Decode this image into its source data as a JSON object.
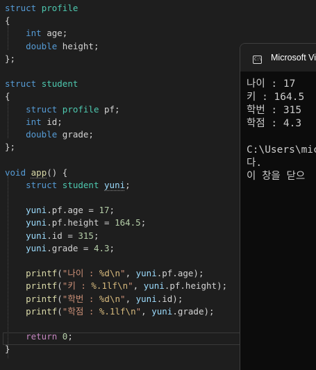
{
  "editor": {
    "lines": [
      [
        [
          "struct",
          "kw"
        ],
        [
          " ",
          "p"
        ],
        [
          "profile",
          "type"
        ]
      ],
      [
        [
          "{",
          "p"
        ]
      ],
      [
        [
          "    ",
          "p"
        ],
        [
          "int",
          "kw"
        ],
        [
          " age;",
          "p"
        ]
      ],
      [
        [
          "    ",
          "p"
        ],
        [
          "double",
          "kw"
        ],
        [
          " height;",
          "p"
        ]
      ],
      [
        [
          "};",
          "p"
        ]
      ],
      [],
      [
        [
          "struct",
          "kw"
        ],
        [
          " ",
          "p"
        ],
        [
          "student",
          "type"
        ]
      ],
      [
        [
          "{",
          "p"
        ]
      ],
      [
        [
          "    ",
          "p"
        ],
        [
          "struct",
          "kw"
        ],
        [
          " ",
          "p"
        ],
        [
          "profile",
          "type"
        ],
        [
          " pf;",
          "p"
        ]
      ],
      [
        [
          "    ",
          "p"
        ],
        [
          "int",
          "kw"
        ],
        [
          " id;",
          "p"
        ]
      ],
      [
        [
          "    ",
          "p"
        ],
        [
          "double",
          "kw"
        ],
        [
          " grade;",
          "p"
        ]
      ],
      [
        [
          "};",
          "p"
        ]
      ],
      [],
      [
        [
          "void",
          "kw"
        ],
        [
          " ",
          "p"
        ],
        [
          "app",
          "func_sq"
        ],
        [
          "() {",
          "p"
        ]
      ],
      [
        [
          "    ",
          "p"
        ],
        [
          "struct",
          "kw"
        ],
        [
          " ",
          "p"
        ],
        [
          "student",
          "type"
        ],
        [
          " ",
          "p"
        ],
        [
          "yuni",
          "var_sq"
        ],
        [
          ";",
          "p"
        ]
      ],
      [],
      [
        [
          "    ",
          "p"
        ],
        [
          "yuni",
          "var"
        ],
        [
          ".pf.age = ",
          "p"
        ],
        [
          "17",
          "num"
        ],
        [
          ";",
          "p"
        ]
      ],
      [
        [
          "    ",
          "p"
        ],
        [
          "yuni",
          "var"
        ],
        [
          ".pf.height = ",
          "p"
        ],
        [
          "164.5",
          "num"
        ],
        [
          ";",
          "p"
        ]
      ],
      [
        [
          "    ",
          "p"
        ],
        [
          "yuni",
          "var"
        ],
        [
          ".id = ",
          "p"
        ],
        [
          "315",
          "num"
        ],
        [
          ";",
          "p"
        ]
      ],
      [
        [
          "    ",
          "p"
        ],
        [
          "yuni",
          "var"
        ],
        [
          ".grade = ",
          "p"
        ],
        [
          "4.3",
          "num"
        ],
        [
          ";",
          "p"
        ]
      ],
      [],
      [
        [
          "    ",
          "p"
        ],
        [
          "printf",
          "func"
        ],
        [
          "(",
          "p"
        ],
        [
          "\"나이 : ",
          "str"
        ],
        [
          "%d",
          "esc"
        ],
        [
          "\\n",
          "esc"
        ],
        [
          "\"",
          "str"
        ],
        [
          ", ",
          "p"
        ],
        [
          "yuni",
          "var"
        ],
        [
          ".pf.age);",
          "p"
        ]
      ],
      [
        [
          "    ",
          "p"
        ],
        [
          "printf",
          "func"
        ],
        [
          "(",
          "p"
        ],
        [
          "\"키 : ",
          "str"
        ],
        [
          "%.1lf",
          "esc"
        ],
        [
          "\\n",
          "esc"
        ],
        [
          "\"",
          "str"
        ],
        [
          ", ",
          "p"
        ],
        [
          "yuni",
          "var"
        ],
        [
          ".pf.height);",
          "p"
        ]
      ],
      [
        [
          "    ",
          "p"
        ],
        [
          "printf",
          "func"
        ],
        [
          "(",
          "p"
        ],
        [
          "\"학번 : ",
          "str"
        ],
        [
          "%d",
          "esc"
        ],
        [
          "\\n",
          "esc"
        ],
        [
          "\"",
          "str"
        ],
        [
          ", ",
          "p"
        ],
        [
          "yuni",
          "var"
        ],
        [
          ".id);",
          "p"
        ]
      ],
      [
        [
          "    ",
          "p"
        ],
        [
          "printf",
          "func"
        ],
        [
          "(",
          "p"
        ],
        [
          "\"학점 : ",
          "str"
        ],
        [
          "%.1lf",
          "esc"
        ],
        [
          "\\n",
          "esc"
        ],
        [
          "\"",
          "str"
        ],
        [
          ", ",
          "p"
        ],
        [
          "yuni",
          "var"
        ],
        [
          ".grade);",
          "p"
        ]
      ],
      [],
      [
        [
          "    ",
          "p"
        ],
        [
          "return",
          "ctrl"
        ],
        [
          " ",
          "p"
        ],
        [
          "0",
          "num"
        ],
        [
          ";",
          "p"
        ]
      ],
      [
        [
          "}",
          "p"
        ]
      ]
    ]
  },
  "console": {
    "title": "Microsoft Vi",
    "icon": "terminal-icon",
    "output": "나이 : 17\n키 : 164.5\n학번 : 315\n학점 : 4.3\n\nC:\\Users\\mic\n다.\n이 창을 닫으"
  },
  "colors": {
    "background": "#1e1e1e",
    "kw": "#569cd6",
    "type": "#4ec9b0",
    "func": "#dcdcaa",
    "var": "#9cdcfe",
    "num": "#b5cea8",
    "str": "#ce9178",
    "esc": "#d7ba7d",
    "ctrl": "#c586c0",
    "p": "#d4d4d4",
    "console_bg": "#0c0c0c",
    "console_text": "#cccccc"
  }
}
